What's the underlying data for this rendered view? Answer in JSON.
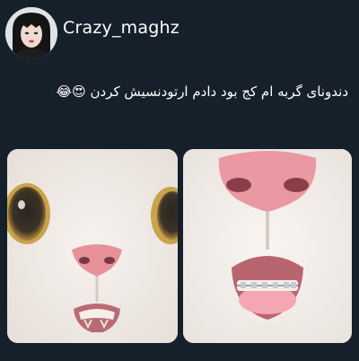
{
  "post": {
    "username": "Crazy_maghz",
    "text": "دندونای گربه ام کج بود دادم ارتودنسیش کردن",
    "emojis": "😍😂"
  },
  "images": {
    "left": "cat-crooked-teeth-photo",
    "right": "cat-braces-photo"
  },
  "colors": {
    "background": "#15202b",
    "text": "#ffffff",
    "cat_nose": "#e8919b"
  }
}
